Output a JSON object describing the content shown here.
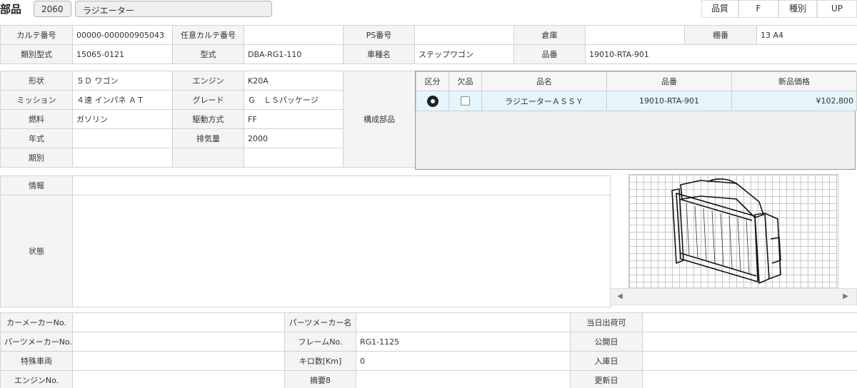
{
  "header": {
    "title": "部品",
    "code": "2060",
    "name": "ラジエーター",
    "quality_label": "品質",
    "quality_value": "F",
    "type_label": "種別",
    "type_value": "UP"
  },
  "info1": {
    "karte_no_label": "カルテ番号",
    "karte_no": "00000-000000905043",
    "opt_karte_label": "任意カルテ番号",
    "opt_karte": "",
    "ps_label": "PS番号",
    "ps": "",
    "warehouse_label": "倉庫",
    "warehouse": "",
    "shelf_label": "棚番",
    "shelf": "13 A4",
    "class_model_label": "類別型式",
    "class_model": "15065-0121",
    "model_label": "型式",
    "model": "DBA-RG1-110",
    "car_name_label": "車種名",
    "car_name": "ステップワゴン",
    "part_no_label": "品番",
    "part_no": "19010-RTA-901"
  },
  "spec": {
    "shape_label": "形状",
    "shape": "５Ｄ ワゴン",
    "engine_label": "エンジン",
    "engine": "K20A",
    "mission_label": "ミッション",
    "mission": "４速 インパネ ＡＴ",
    "grade_label": "グレード",
    "grade": "Ｇ　ＬＳパッケージ",
    "fuel_label": "燃料",
    "fuel": "ガソリン",
    "drive_label": "駆動方式",
    "drive": "FF",
    "year_label": "年式",
    "year": "",
    "displacement_label": "排気量",
    "displacement": "2000",
    "period_label": "期別",
    "period": "",
    "components_label": "構成部品"
  },
  "parts_table": {
    "headers": [
      "区分",
      "欠品",
      "品名",
      "品番",
      "新品価格"
    ],
    "row": {
      "name": "ラジエーターＡＳＳＹ",
      "part_no": "19010-RTA-901",
      "price": "¥102,800"
    }
  },
  "notes": {
    "info_label": "情報",
    "info": "",
    "status_label": "状態",
    "status": ""
  },
  "image": {
    "icon": "radiator-drawing-icon"
  },
  "bottom": {
    "car_maker_no_label": "カーメーカーNo.",
    "car_maker_no": "",
    "parts_maker_name_label": "パーツメーカー名",
    "parts_maker_name": "",
    "same_day_label": "当日出荷可",
    "same_day": "",
    "parts_maker_no_label": "パーツメーカーNo.",
    "parts_maker_no": "",
    "frame_no_label": "フレームNo.",
    "frame_no": "RG1-1125",
    "publish_date_label": "公開日",
    "publish_date": "",
    "special_vehicle_label": "特殊車両",
    "special_vehicle": "",
    "mileage_label": "キロ数[Km]",
    "mileage": "0",
    "arrival_date_label": "入庫日",
    "arrival_date": "",
    "engine_no_label": "エンジンNo.",
    "engine_no": "",
    "summary8_label": "摘要8",
    "summary8": "",
    "updated_label": "更新日",
    "updated": ""
  }
}
